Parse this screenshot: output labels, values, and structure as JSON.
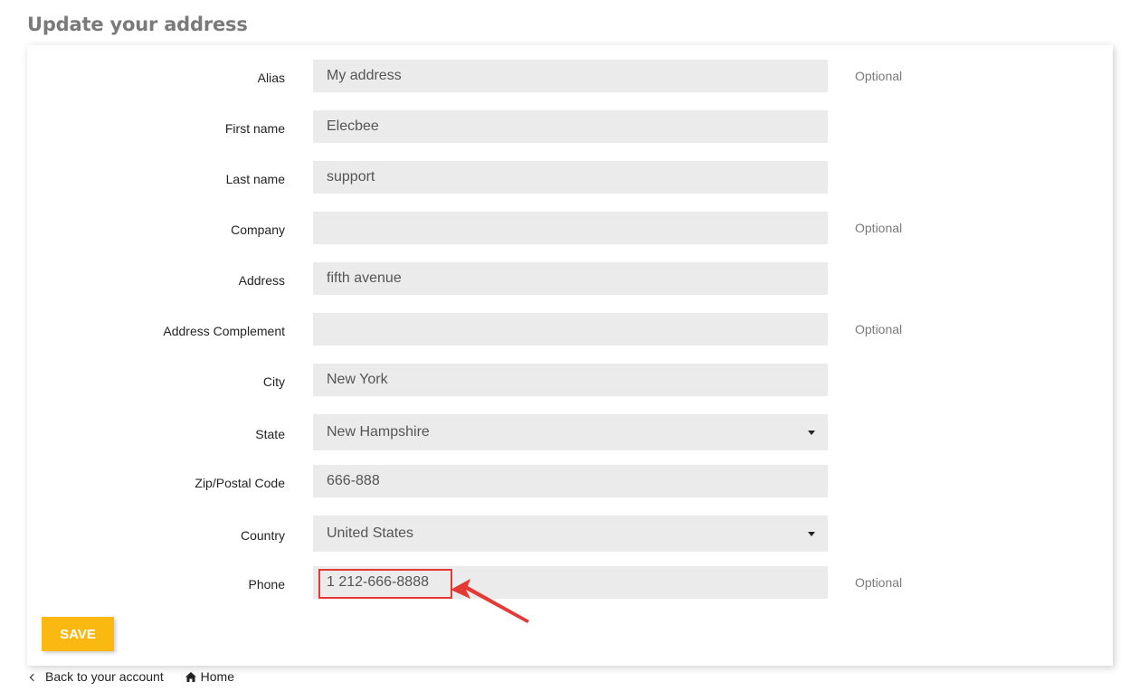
{
  "page": {
    "title": "Update your address"
  },
  "form": {
    "fields": [
      {
        "label": "Alias",
        "value": "My address",
        "comment": "Optional"
      },
      {
        "label": "First name",
        "value": "Elecbee",
        "comment": ""
      },
      {
        "label": "Last name",
        "value": "support",
        "comment": ""
      },
      {
        "label": "Company",
        "value": "",
        "comment": "Optional"
      },
      {
        "label": "Address",
        "value": "fifth avenue",
        "comment": ""
      },
      {
        "label": "Address Complement",
        "value": "",
        "comment": "Optional"
      },
      {
        "label": "City",
        "value": "New York",
        "comment": ""
      },
      {
        "label": "State",
        "value": "New Hampshire",
        "comment": ""
      },
      {
        "label": "Zip/Postal Code",
        "value": "666-888",
        "comment": ""
      },
      {
        "label": "Country",
        "value": "United States",
        "comment": ""
      },
      {
        "label": "Phone",
        "value": "1 212-666-8888",
        "comment": "Optional"
      }
    ],
    "save_label": "Save"
  },
  "footer": {
    "back_label": "Back to your account",
    "home_label": "Home"
  },
  "colors": {
    "accent": "#fbb811",
    "input_bg": "#ebebeb",
    "annotation": "#e53935"
  },
  "icons": {
    "back": "chevron-left-icon",
    "home": "home-icon",
    "select": "caret-down-icon"
  }
}
